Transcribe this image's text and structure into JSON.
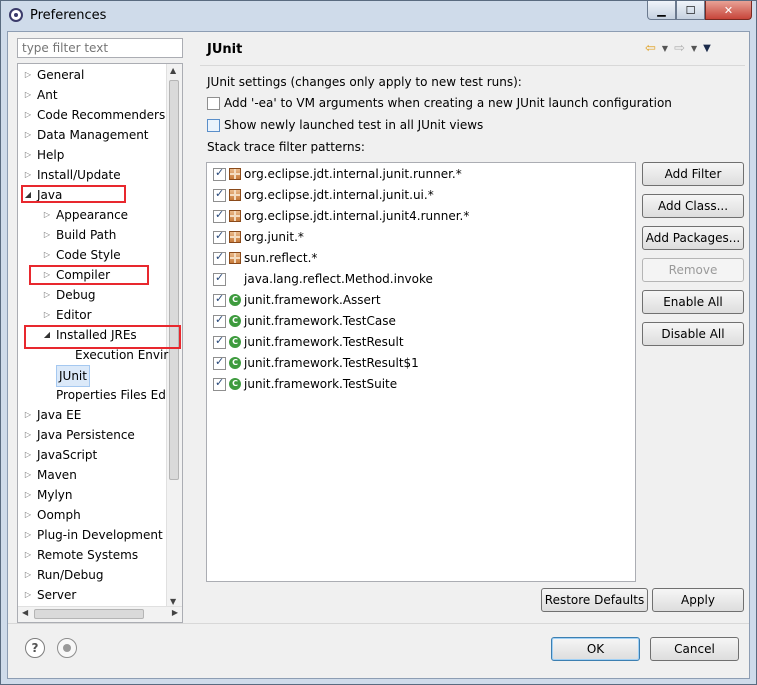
{
  "window": {
    "title": "Preferences"
  },
  "sidebar": {
    "filter_placeholder": "type filter text",
    "items": [
      {
        "label": "General",
        "level": 0,
        "state": "collapsed"
      },
      {
        "label": "Ant",
        "level": 0,
        "state": "collapsed"
      },
      {
        "label": "Code Recommenders",
        "level": 0,
        "state": "collapsed"
      },
      {
        "label": "Data Management",
        "level": 0,
        "state": "collapsed"
      },
      {
        "label": "Help",
        "level": 0,
        "state": "collapsed"
      },
      {
        "label": "Install/Update",
        "level": 0,
        "state": "collapsed"
      },
      {
        "label": "Java",
        "level": 0,
        "state": "expanded"
      },
      {
        "label": "Appearance",
        "level": 1,
        "state": "collapsed"
      },
      {
        "label": "Build Path",
        "level": 1,
        "state": "collapsed"
      },
      {
        "label": "Code Style",
        "level": 1,
        "state": "collapsed"
      },
      {
        "label": "Compiler",
        "level": 1,
        "state": "collapsed"
      },
      {
        "label": "Debug",
        "level": 1,
        "state": "collapsed"
      },
      {
        "label": "Editor",
        "level": 1,
        "state": "collapsed"
      },
      {
        "label": "Installed JREs",
        "level": 1,
        "state": "expanded"
      },
      {
        "label": "Execution Envir",
        "level": 2,
        "state": "leaf"
      },
      {
        "label": "JUnit",
        "level": 1,
        "state": "leaf",
        "selected": true
      },
      {
        "label": "Properties Files Ed",
        "level": 1,
        "state": "leaf"
      },
      {
        "label": "Java EE",
        "level": 0,
        "state": "collapsed"
      },
      {
        "label": "Java Persistence",
        "level": 0,
        "state": "collapsed"
      },
      {
        "label": "JavaScript",
        "level": 0,
        "state": "collapsed"
      },
      {
        "label": "Maven",
        "level": 0,
        "state": "collapsed"
      },
      {
        "label": "Mylyn",
        "level": 0,
        "state": "collapsed"
      },
      {
        "label": "Oomph",
        "level": 0,
        "state": "collapsed"
      },
      {
        "label": "Plug-in Development",
        "level": 0,
        "state": "collapsed"
      },
      {
        "label": "Remote Systems",
        "level": 0,
        "state": "collapsed"
      },
      {
        "label": "Run/Debug",
        "level": 0,
        "state": "collapsed"
      },
      {
        "label": "Server",
        "level": 0,
        "state": "collapsed"
      }
    ]
  },
  "page": {
    "title": "JUnit",
    "settings_label": "JUnit settings (changes only apply to new test runs):",
    "option_ea": {
      "label": "Add '-ea' to VM arguments when creating a new JUnit launch configuration",
      "checked": false
    },
    "option_show": {
      "label": "Show newly launched test in all JUnit views",
      "checked": false
    },
    "patterns_label": "Stack trace filter patterns:",
    "patterns": [
      {
        "label": "org.eclipse.jdt.internal.junit.runner.*",
        "icon": "package-icon",
        "checked": true
      },
      {
        "label": "org.eclipse.jdt.internal.junit.ui.*",
        "icon": "package-icon",
        "checked": true
      },
      {
        "label": "org.eclipse.jdt.internal.junit4.runner.*",
        "icon": "package-icon",
        "checked": true
      },
      {
        "label": "org.junit.*",
        "icon": "package-icon",
        "checked": true
      },
      {
        "label": "sun.reflect.*",
        "icon": "package-icon",
        "checked": true
      },
      {
        "label": "java.lang.reflect.Method.invoke",
        "icon": "none",
        "checked": true
      },
      {
        "label": "junit.framework.Assert",
        "icon": "class-icon",
        "checked": true
      },
      {
        "label": "junit.framework.TestCase",
        "icon": "class-icon",
        "checked": true
      },
      {
        "label": "junit.framework.TestResult",
        "icon": "class-icon",
        "checked": true
      },
      {
        "label": "junit.framework.TestResult$1",
        "icon": "class-icon",
        "checked": true
      },
      {
        "label": "junit.framework.TestSuite",
        "icon": "class-icon",
        "checked": true
      }
    ],
    "buttons": {
      "add_filter": "Add Filter",
      "add_class": "Add Class...",
      "add_packages": "Add Packages...",
      "remove": "Remove",
      "enable_all": "Enable All",
      "disable_all": "Disable All",
      "restore_defaults": "Restore Defaults",
      "apply": "Apply"
    }
  },
  "footer": {
    "ok": "OK",
    "cancel": "Cancel"
  },
  "colors": {
    "highlight_box": "#e8282e",
    "class_icon": "#3e9b3e"
  }
}
